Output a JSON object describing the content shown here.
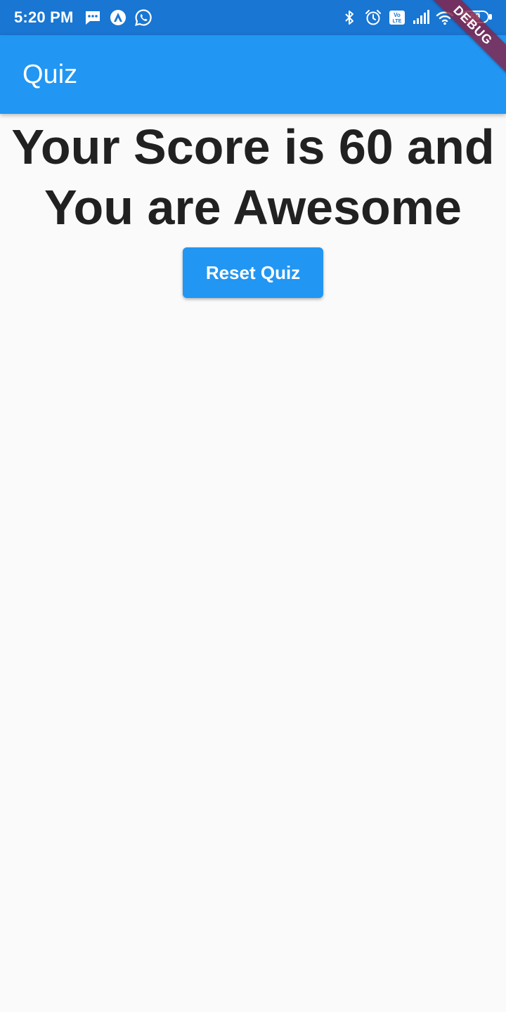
{
  "status_bar": {
    "time": "5:20 PM",
    "left_icons": [
      "message-icon",
      "navigation-app-icon",
      "whatsapp-icon"
    ],
    "right_icons": [
      "bluetooth-icon",
      "alarm-icon",
      "volte-icon",
      "signal-icon",
      "wifi-icon"
    ],
    "battery_level": "69",
    "battery_fraction": 0.69
  },
  "app_bar": {
    "title": "Quiz"
  },
  "debug_banner": {
    "label": "DEBUG"
  },
  "result": {
    "message": "Your Score is 60 and You are Awesome",
    "reset_label": "Reset Quiz"
  },
  "colors": {
    "status_bar": "#1976d2",
    "primary": "#2196f3",
    "background": "#fafafa",
    "text": "#212121",
    "debug_banner": "#882143"
  }
}
